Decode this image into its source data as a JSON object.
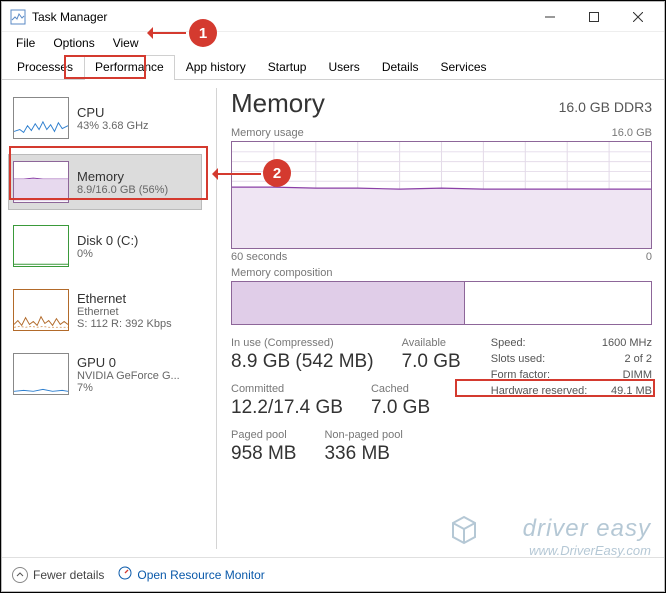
{
  "window_title": "Task Manager",
  "menu": {
    "file": "File",
    "options": "Options",
    "view": "View"
  },
  "tabs": {
    "processes": "Processes",
    "performance": "Performance",
    "app_history": "App history",
    "startup": "Startup",
    "users": "Users",
    "details": "Details",
    "services": "Services"
  },
  "sidebar": {
    "cpu": {
      "title": "CPU",
      "sub": "43% 3.68 GHz",
      "stroke": "#2e7fcf"
    },
    "memory": {
      "title": "Memory",
      "sub": "8.9/16.0 GB (56%)",
      "stroke": "#8a3fa6"
    },
    "disk": {
      "title": "Disk 0 (C:)",
      "sub": "0%",
      "stroke": "#3a9a3a"
    },
    "ethernet": {
      "title": "Ethernet",
      "sub": "Ethernet",
      "sub2": "S: 112 R: 392 Kbps",
      "stroke": "#b26a2a"
    },
    "gpu": {
      "title": "GPU 0",
      "sub": "NVIDIA GeForce G...",
      "sub2": "7%",
      "stroke": "#2e7fcf"
    }
  },
  "main": {
    "title": "Memory",
    "subtitle": "16.0 GB DDR3",
    "usage_label": "Memory usage",
    "usage_max": "16.0 GB",
    "axis_left": "60 seconds",
    "axis_right": "0",
    "composition_label": "Memory composition",
    "stats": {
      "in_use_label": "In use (Compressed)",
      "in_use_val": "8.9 GB (542 MB)",
      "available_label": "Available",
      "available_val": "7.0 GB",
      "committed_label": "Committed",
      "committed_val": "12.2/17.4 GB",
      "cached_label": "Cached",
      "cached_val": "7.0 GB",
      "paged_label": "Paged pool",
      "paged_val": "958 MB",
      "nonpaged_label": "Non-paged pool",
      "nonpaged_val": "336 MB"
    },
    "kv": {
      "speed_k": "Speed:",
      "speed_v": "1600 MHz",
      "slots_k": "Slots used:",
      "slots_v": "2 of 2",
      "ff_k": "Form factor:",
      "ff_v": "DIMM",
      "hw_k": "Hardware reserved:",
      "hw_v": "49.1 MB"
    }
  },
  "footer": {
    "fewer": "Fewer details",
    "orm": "Open Resource Monitor"
  },
  "anno": {
    "one": "1",
    "two": "2"
  },
  "watermark": {
    "brand": "driver easy",
    "url": "www.DriverEasy.com"
  },
  "chart_data": {
    "type": "line",
    "title": "Memory usage",
    "xlabel": "seconds ago",
    "ylabel": "GB",
    "ylim": [
      0,
      16.0
    ],
    "x_range_seconds": [
      60,
      0
    ],
    "series": [
      {
        "name": "Memory usage (GB)",
        "values": [
          9.1,
          9.1,
          9.0,
          9.0,
          8.9,
          9.0,
          8.9,
          8.9,
          8.9,
          8.9,
          8.9,
          8.9,
          8.9
        ]
      }
    ],
    "composition": {
      "in_use_gb": 8.9,
      "compressed_gb": 0.542,
      "available_gb": 7.0,
      "total_gb": 16.0
    }
  }
}
